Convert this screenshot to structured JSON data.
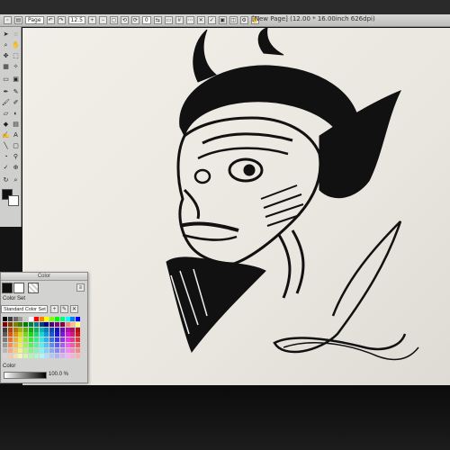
{
  "window": {
    "title": "[New Page] (12.00 * 16.00inch 626dpi)"
  },
  "toolbar": {
    "page_label": "Page",
    "zoom_value": "12.5",
    "angle_value": "0"
  },
  "tools": [
    "select-arrow",
    "lasso",
    "magnifier",
    "hand",
    "pen",
    "pencil",
    "brush",
    "airbrush",
    "eraser",
    "fill-bucket",
    "text",
    "rectangle",
    "eyedropper",
    "zoom-loupe"
  ],
  "color_panel": {
    "title": "Color",
    "color_set_label": "Color Set",
    "color_set_selected": "Standard Color Set",
    "opacity_label": "Color",
    "opacity_value": "100.0 %",
    "main_color": "#111111",
    "sub_color": "#ffffff",
    "swatch_colors": [
      "#000000",
      "#3a3a3a",
      "#6a6a6a",
      "#9a9a9a",
      "#cacaca",
      "#ffffff",
      "#ff0000",
      "#ff7f00",
      "#ffff00",
      "#7fff00",
      "#00ff00",
      "#00ff7f",
      "#00ffff",
      "#007fff",
      "#0000ff",
      "#800000",
      "#804000",
      "#808000",
      "#408000",
      "#008000",
      "#008040",
      "#008080",
      "#004080",
      "#000080",
      "#400080",
      "#800080",
      "#800040",
      "#ff8080",
      "#ffbf80",
      "#ffff80"
    ]
  }
}
